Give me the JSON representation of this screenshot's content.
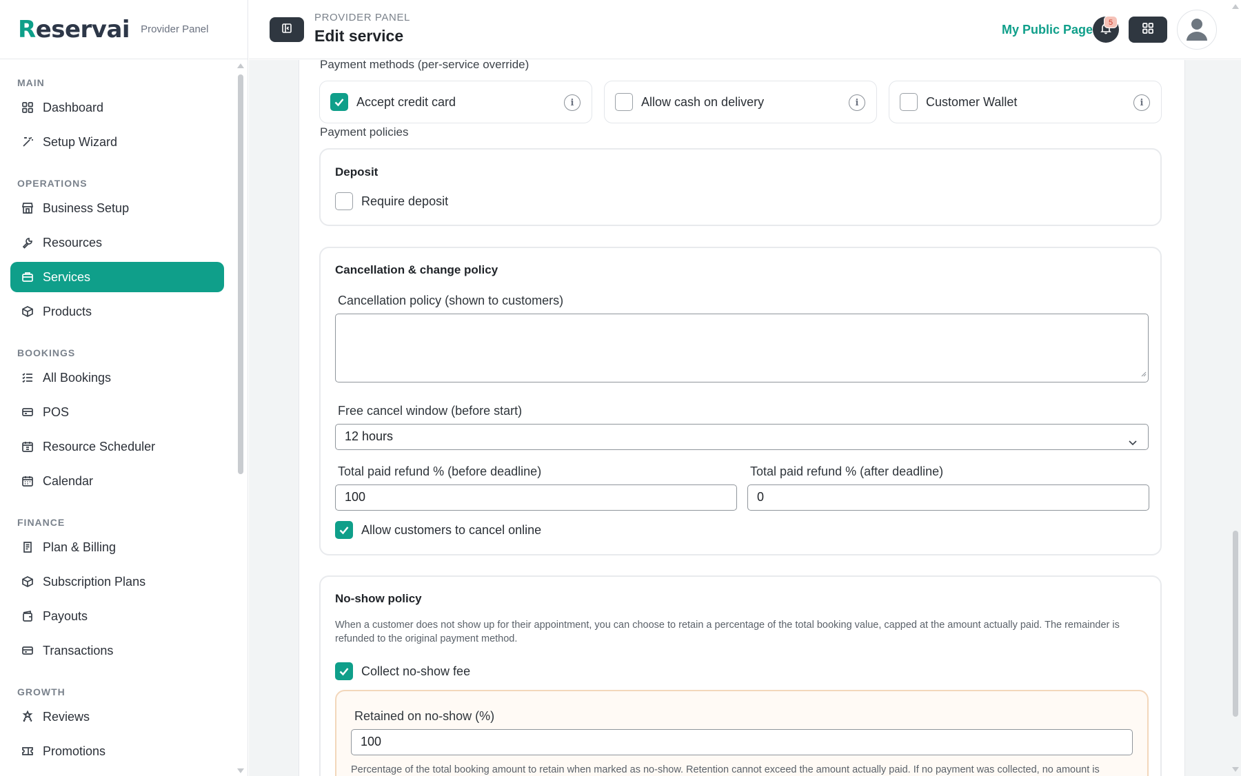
{
  "brand": {
    "logo": "Reservai",
    "logo_initial": "R",
    "logo_rest": "eservai",
    "panel_tag": "Provider Panel"
  },
  "header": {
    "crumb": "PROVIDER PANEL",
    "title": "Edit service",
    "public_link": "My Public Page",
    "notifications_count": "5"
  },
  "sidebar": {
    "sections": [
      {
        "label": "MAIN",
        "items": [
          {
            "label": "Dashboard",
            "icon": "grid-icon"
          },
          {
            "label": "Setup Wizard",
            "icon": "magic-wand-icon"
          }
        ]
      },
      {
        "label": "OPERATIONS",
        "items": [
          {
            "label": "Business Setup",
            "icon": "store-icon"
          },
          {
            "label": "Resources",
            "icon": "wrench-icon"
          },
          {
            "label": "Services",
            "icon": "briefcase-icon",
            "active": true
          },
          {
            "label": "Products",
            "icon": "box-icon"
          }
        ]
      },
      {
        "label": "BOOKINGS",
        "items": [
          {
            "label": "All Bookings",
            "icon": "list-check-icon"
          },
          {
            "label": "POS",
            "icon": "card-icon"
          },
          {
            "label": "Resource Scheduler",
            "icon": "calendar-clock-icon"
          },
          {
            "label": "Calendar",
            "icon": "calendar-icon"
          }
        ]
      },
      {
        "label": "FINANCE",
        "items": [
          {
            "label": "Plan & Billing",
            "icon": "receipt-icon"
          },
          {
            "label": "Subscription Plans",
            "icon": "box-icon"
          },
          {
            "label": "Payouts",
            "icon": "wallet-icon"
          },
          {
            "label": "Transactions",
            "icon": "card-icon"
          }
        ]
      },
      {
        "label": "GROWTH",
        "items": [
          {
            "label": "Reviews",
            "icon": "stars-icon"
          },
          {
            "label": "Promotions",
            "icon": "ticket-icon"
          }
        ]
      }
    ]
  },
  "payment_methods": {
    "label": "Payment methods (per-service override)",
    "options": [
      {
        "label": "Accept credit card",
        "checked": true
      },
      {
        "label": "Allow cash on delivery",
        "checked": false
      },
      {
        "label": "Customer Wallet",
        "checked": false
      }
    ]
  },
  "payment_policies": {
    "label": "Payment policies",
    "deposit": {
      "title": "Deposit",
      "require_label": "Require deposit",
      "require_checked": false
    },
    "cancellation": {
      "title": "Cancellation & change policy",
      "policy_label": "Cancellation policy (shown to customers)",
      "policy_value": "",
      "window_label": "Free cancel window (before start)",
      "window_value": "12 hours",
      "refund_before_label": "Total paid refund % (before deadline)",
      "refund_before_value": "100",
      "refund_after_label": "Total paid refund % (after deadline)",
      "refund_after_value": "0",
      "allow_online_label": "Allow customers to cancel online",
      "allow_online_checked": true
    },
    "no_show": {
      "title": "No-show policy",
      "description": "When a customer does not show up for their appointment, you can choose to retain a percentage of the total booking value, capped at the amount actually paid. The remainder is refunded to the original payment method.",
      "collect_label": "Collect no-show fee",
      "collect_checked": true,
      "retained_label": "Retained on no-show (%)",
      "retained_value": "100",
      "retained_help": "Percentage of the total booking amount to retain when marked as no-show. Retention cannot exceed the amount actually paid. If no payment was collected, no amount is"
    }
  },
  "colors": {
    "accent": "#0f9f8a",
    "dark_button": "#2f3740"
  }
}
